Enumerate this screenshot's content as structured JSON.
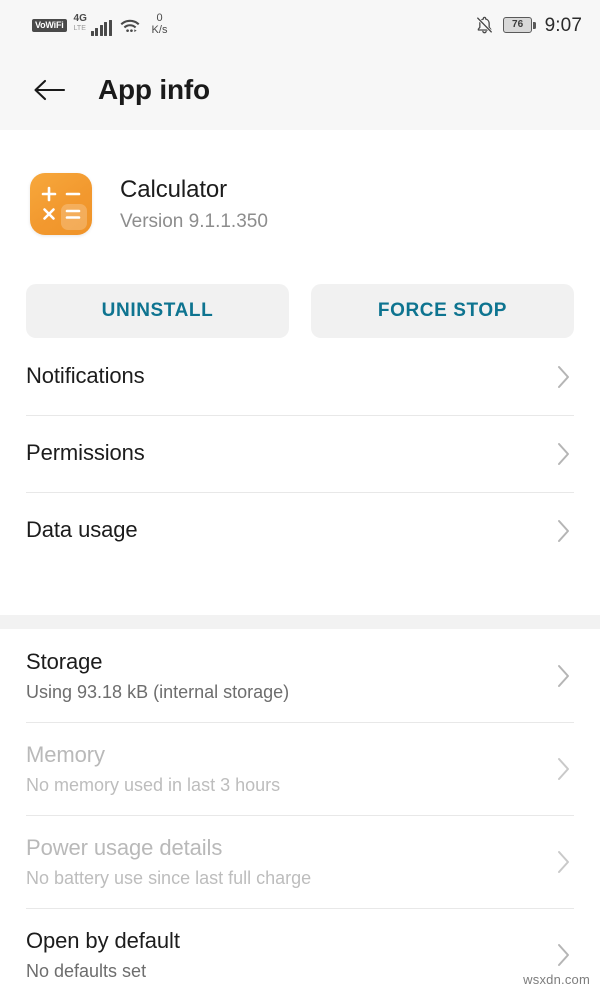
{
  "status_bar": {
    "vowifi_badge": "VoWiFi",
    "network_generation": "4G",
    "network_sub": "LTE",
    "signal_bars": 5,
    "wifi_icon": "wifi-icon",
    "net_speed_value": "0",
    "net_speed_unit": "K/s",
    "mute_icon": "bell-muted-icon",
    "battery_level": "76",
    "time": "9:07"
  },
  "header": {
    "back_icon": "arrow-left-icon",
    "title": "App info"
  },
  "app": {
    "icon_name": "calculator-app-icon",
    "icon_color": "#f2992f",
    "icon_symbols": [
      "+",
      "−",
      "×",
      "="
    ],
    "name": "Calculator",
    "version": "Version 9.1.1.350"
  },
  "actions": {
    "uninstall_label": "UNINSTALL",
    "force_stop_label": "FORCE STOP",
    "accent_color": "#0e7490"
  },
  "sections": [
    {
      "rows": [
        {
          "title": "Notifications",
          "subtitle": "",
          "disabled": false
        },
        {
          "title": "Permissions",
          "subtitle": "",
          "disabled": false
        },
        {
          "title": "Data usage",
          "subtitle": "",
          "disabled": false
        }
      ]
    },
    {
      "rows": [
        {
          "title": "Storage",
          "subtitle": "Using 93.18 kB (internal storage)",
          "disabled": false
        },
        {
          "title": "Memory",
          "subtitle": "No memory used in last 3 hours",
          "disabled": true
        },
        {
          "title": "Power usage details",
          "subtitle": "No battery use since last full charge",
          "disabled": true
        },
        {
          "title": "Open by default",
          "subtitle": "No defaults set",
          "disabled": false
        }
      ]
    }
  ],
  "watermark": "wsxdn.com"
}
